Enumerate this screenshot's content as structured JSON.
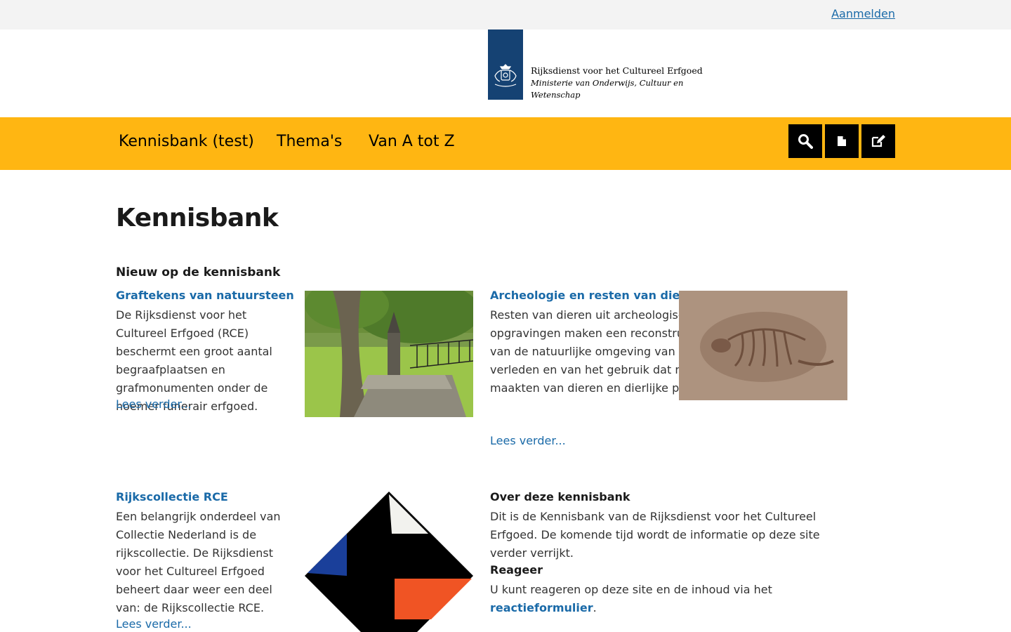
{
  "topbar": {
    "login_label": "Aanmelden"
  },
  "logo": {
    "line1": "Rijksdienst voor het Cultureel Erfgoed",
    "line2": "Ministerie van Onderwijs, Cultuur en",
    "line3": "Wetenschap"
  },
  "nav": {
    "items": [
      {
        "label": "Kennisbank (test)"
      },
      {
        "label": "Thema's"
      },
      {
        "label": "Van A tot Z"
      }
    ],
    "buttons": [
      "search-icon",
      "document-icon",
      "edit-icon"
    ]
  },
  "colors": {
    "nav_bg": "#ffb612",
    "topbar_bg": "#f3f3f3",
    "link": "#1a6aa8",
    "logo_blue": "#154273"
  },
  "page": {
    "title": "Kennisbank"
  },
  "new_section": {
    "heading": "Nieuw op de kennisbank",
    "items": [
      {
        "title": "Graftekens van natuursteen",
        "text": "De Rijksdienst voor het Cultureel Erfgoed (RCE) beschermt een groot aantal begraafplaatsen en grafmonumenten onder de noemer funerair erfgoed.",
        "read_more": "Lees verder..."
      },
      {
        "title": "Archeologie en resten van dieren",
        "text": "Resten van dieren uit archeologische opgravingen maken een reconstructie mogelijk van de natuurlijke omgeving van de mens in het verleden en van het gebruik dat mensen maakten van dieren en dierlijke producten.",
        "read_more": "Lees verder..."
      },
      {
        "title": "Rijkscollectie RCE",
        "text": "Een belangrijk onderdeel van Collectie Nederland is de rijkscollectie. De Rijksdienst voor het Cultureel Erfgoed beheert daar weer een deel van: de Rijkscollectie RCE.",
        "read_more": "Lees verder..."
      }
    ]
  },
  "about": {
    "heading": "Over deze kennisbank",
    "text": "Dit is de Kennisbank van de Rijksdienst voor het Cultureel Erfgoed. De komende tijd wordt de informatie op deze site verder verrijkt.",
    "feedback_heading": "Reageer",
    "feedback_text": "U kunt reageren op deze site en de inhoud via het",
    "feedback_link": "reactieformulier",
    "feedback_end": "."
  }
}
